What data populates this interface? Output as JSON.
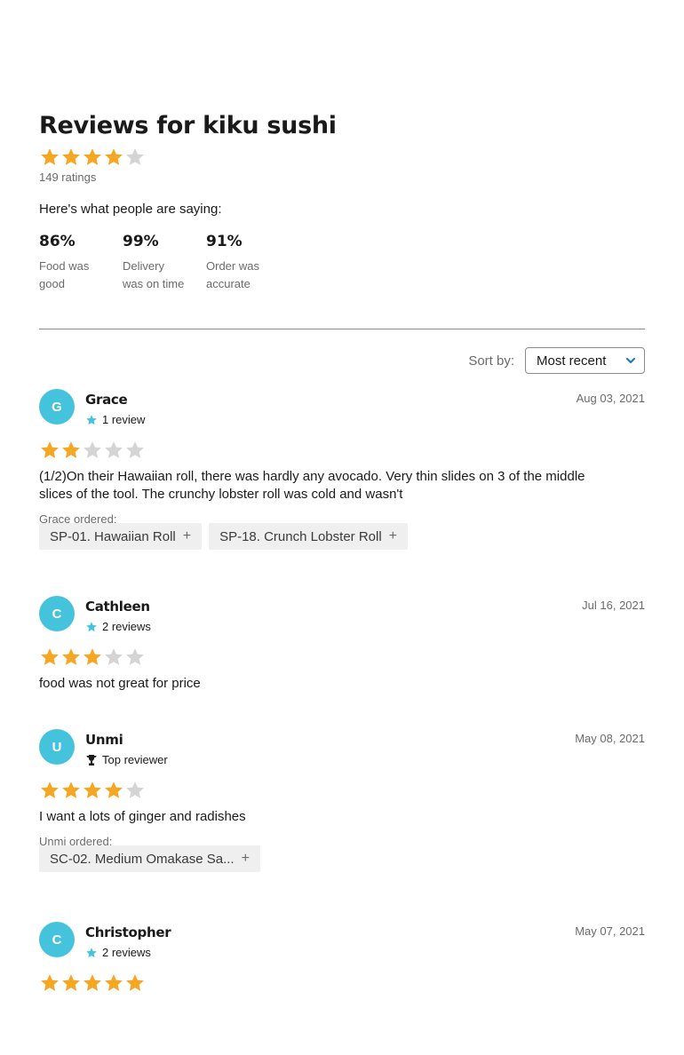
{
  "header": {
    "title": "Reviews for kiku sushi",
    "rating": 4,
    "ratings_count": "149 ratings",
    "saying": "Here's what people are saying:"
  },
  "stats": [
    {
      "pct": "86%",
      "label": "Food was good"
    },
    {
      "pct": "99%",
      "label": "Delivery was on time"
    },
    {
      "pct": "91%",
      "label": "Order was accurate"
    }
  ],
  "sort": {
    "label": "Sort by:",
    "value": "Most recent"
  },
  "colors": {
    "star_filled": "#f5a623",
    "star_empty": "#d4d4d4",
    "avatar": "#45c3dd",
    "accent": "#1a73c9"
  },
  "reviews": [
    {
      "initial": "G",
      "name": "Grace",
      "meta": "1 review",
      "meta_icon": "star-icon",
      "date": "Aug 03, 2021",
      "rating": 2,
      "text": "(1/2)On their Hawaiian roll, there was hardly any avocado. Very thin slides on 3 of the middle slices of the tool. The crunchy lobster roll was cold and wasn't",
      "ordered_label": "Grace ordered:",
      "items": [
        "SP-01. Hawaiian Roll",
        "SP-18. Crunch Lobster Roll"
      ]
    },
    {
      "initial": "C",
      "name": "Cathleen",
      "meta": "2 reviews",
      "meta_icon": "star-icon",
      "date": "Jul 16, 2021",
      "rating": 3,
      "text": "food was not great for price",
      "ordered_label": "",
      "items": []
    },
    {
      "initial": "U",
      "name": "Unmi",
      "meta": "Top reviewer",
      "meta_icon": "trophy-icon",
      "date": "May 08, 2021",
      "rating": 4,
      "text": "I want a lots of ginger and radishes",
      "ordered_label": "Unmi ordered:",
      "items": [
        "SC-02. Medium Omakase Sa..."
      ]
    },
    {
      "initial": "C",
      "name": "Christopher",
      "meta": "2 reviews",
      "meta_icon": "star-icon",
      "date": "May 07, 2021",
      "rating": 5,
      "text": "",
      "ordered_label": "",
      "items": []
    }
  ]
}
